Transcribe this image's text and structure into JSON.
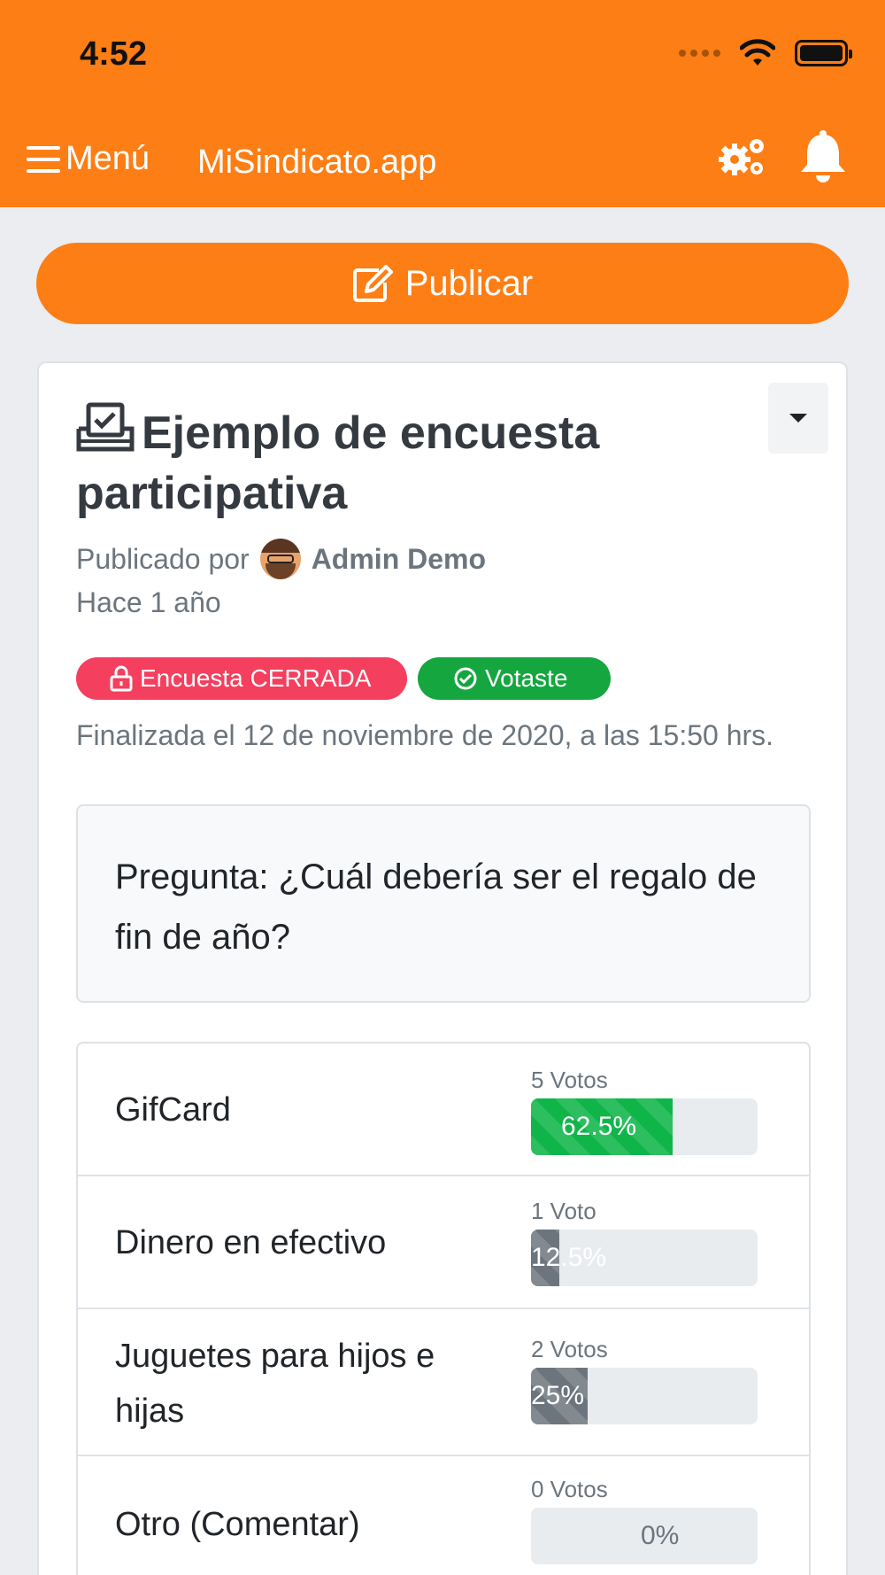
{
  "status_bar": {
    "time": "4:52"
  },
  "nav": {
    "menu_label": "Menú",
    "app_title": "MiSindicato.app"
  },
  "publish": {
    "label": "Publicar"
  },
  "post": {
    "title": "Ejemplo de encuesta participativa",
    "published_by": "Publicado por",
    "author": "Admin Demo",
    "time_ago": "Hace 1 año",
    "badge_closed": "Encuesta CERRADA",
    "badge_voted": "Votaste",
    "closed_note": "Finalizada el 12 de noviembre de 2020, a las 15:50 hrs.",
    "question": "Pregunta: ¿Cuál debería ser el regalo de fin de año?"
  },
  "options": [
    {
      "label": "GifCard",
      "votes": "5 Votos",
      "percent_label": "62.5%",
      "percent": 62.5
    },
    {
      "label": "Dinero en efectivo",
      "votes": "1 Voto",
      "percent_label": "12.5%",
      "percent": 12.5
    },
    {
      "label": "Juguetes para hijos e hijas",
      "votes": "2 Votos",
      "percent_label": "25%",
      "percent": 25
    },
    {
      "label": "Otro (Comentar)",
      "votes": "0 Votos",
      "percent_label": "0%",
      "percent": 0
    }
  ],
  "colors": {
    "brand": "#fd7e14",
    "closed": "#f43f5e",
    "voted": "#15a63f",
    "bar_top": "#10b54a",
    "bar_other": "#6c757d"
  }
}
